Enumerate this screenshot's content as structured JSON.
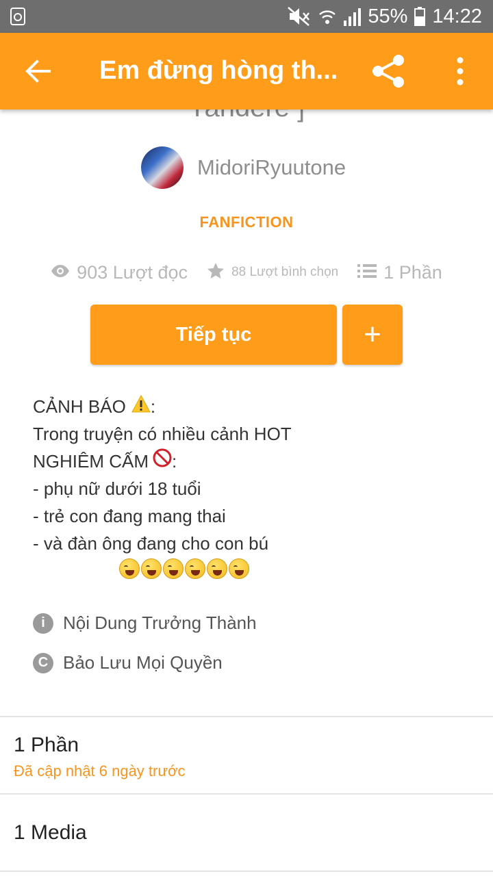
{
  "status_bar": {
    "battery": "55%",
    "time": "14:22"
  },
  "app_bar": {
    "title": "Em đừng hòng th...",
    "icons": [
      "back-arrow-icon",
      "share-icon",
      "more-vert-icon"
    ]
  },
  "story": {
    "title_tail": "Yandere ]",
    "author": "MidoriRyuutone",
    "category": "FANFICTION",
    "stats": {
      "reads": "903 Lượt đọc",
      "votes": "88 Lượt bình chọn",
      "parts": "1 Phần"
    },
    "continue_label": "Tiếp tục",
    "add_label": "+",
    "description": {
      "line1": "CẢNH BÁO",
      "line1_suffix": ":",
      "line2": "Trong truyện có nhiều cảnh HOT",
      "line3": "NGHIÊM CẤM",
      "line3_suffix": ":",
      "line4": "- phụ nữ dưới 18 tuổi",
      "line5": "- trẻ con đang mang thai",
      "line6": "- và đàn ông đang cho con bú"
    },
    "mature_label": "Nội Dung Trưởng Thành",
    "copyright_label": "Bảo Lưu Mọi Quyền"
  },
  "parts_section": {
    "title": "1 Phần",
    "updated": "Đã cập nhật 6 ngày trước"
  },
  "media_section": {
    "title": "1 Media"
  },
  "colors": {
    "accent": "#ff9c1a",
    "accent_text": "#f7941d",
    "status_bar": "#6e6e6e"
  }
}
